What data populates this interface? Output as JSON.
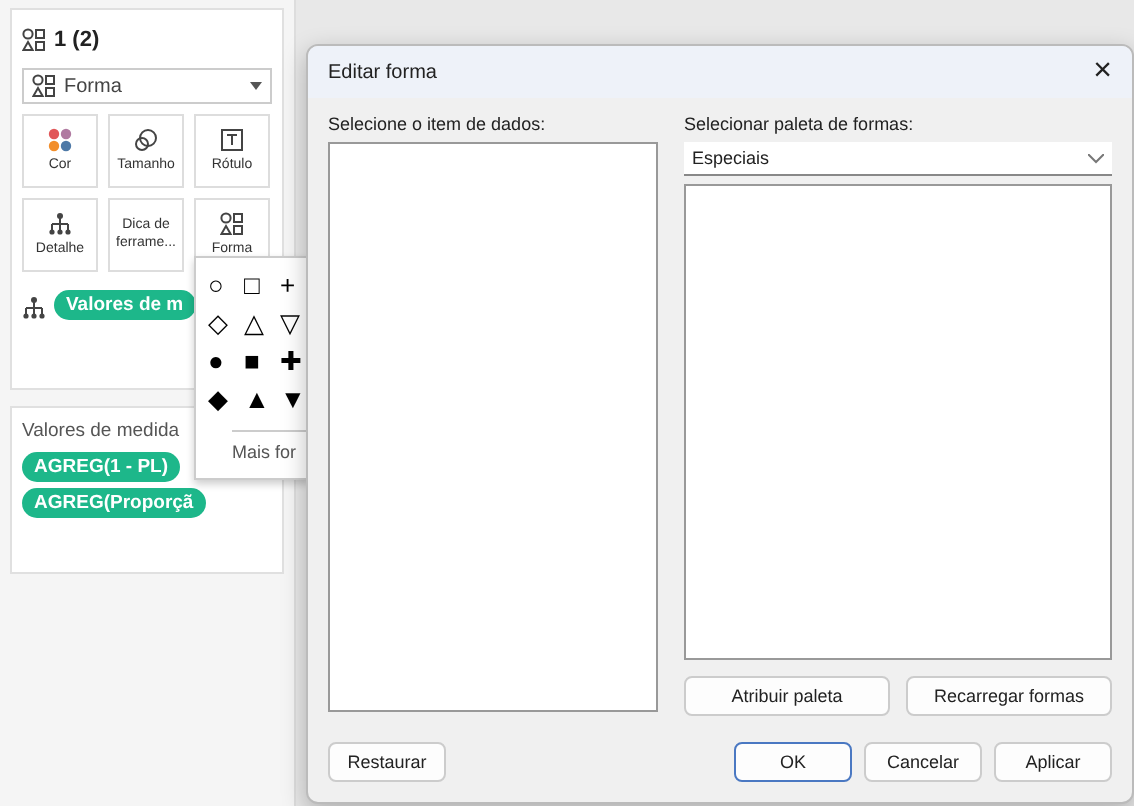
{
  "sheet": {
    "title": "1 (2)",
    "mark_type": "Forma",
    "mark_buttons": [
      {
        "kind": "color",
        "label": "Cor"
      },
      {
        "kind": "size",
        "label": "Tamanho"
      },
      {
        "kind": "label",
        "label": "Rótulo"
      },
      {
        "kind": "detail",
        "label": "Detalhe"
      },
      {
        "kind": "tooltip",
        "label": "Dica de ferrame..."
      },
      {
        "kind": "shape",
        "label": "Forma"
      }
    ],
    "mark_pill": "Valores de m",
    "measure_values": {
      "title": "Valores de medida",
      "pills": [
        "AGREG(1 - PL)",
        "AGREG(Proporçã"
      ]
    }
  },
  "shape_popup": {
    "shapes": [
      "○",
      "□",
      "+",
      "◇",
      "△",
      "▽",
      "●",
      "■",
      "✚",
      "◆",
      "▲",
      "▼"
    ],
    "more": "Mais for"
  },
  "dialog": {
    "title": "Editar forma",
    "close": "×",
    "data_item_label": "Selecione o item de dados:",
    "palette_label": "Selecionar paleta de formas:",
    "palette": "Especiais",
    "palette_buttons": [
      "Atribuir paleta",
      "Recarregar formas"
    ],
    "restore": "Restaurar",
    "buttons": [
      {
        "label": "OK",
        "selected": true
      },
      {
        "label": "Cancelar",
        "selected": false
      },
      {
        "label": "Aplicar",
        "selected": false
      }
    ]
  }
}
